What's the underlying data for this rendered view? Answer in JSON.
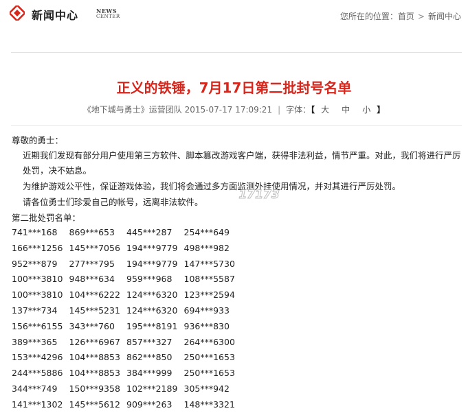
{
  "header": {
    "section_title": "新闻中心",
    "news_logo_line1": "NEWS",
    "news_logo_line2": "CENTER",
    "breadcrumb_prefix": "您所在的位置：",
    "breadcrumb_home": "首页",
    "breadcrumb_sep": ">",
    "breadcrumb_current": "新闻中心",
    "accent_color": "#d7261c"
  },
  "article": {
    "title": "正义的铁锤，7月17日第二批封号名单",
    "source": "《地下城与勇士》运营团队",
    "datetime": "2015-07-17 17:09:21",
    "font_label": "字体：",
    "bracket_open": "【",
    "bracket_close": "】",
    "font_sizes": [
      "大",
      "中",
      "小"
    ]
  },
  "body": {
    "greeting": "尊敬的勇士：",
    "para1": "近期我们发现有部分用户使用第三方软件、脚本篡改游戏客户端，获得非法利益，情节严重。对此，我们将进行严厉处罚，决不姑息。",
    "para2": "为维护游戏公平性，保证游戏体验，我们将会通过多方面监测外挂使用情况，并对其进行严厉处罚。",
    "para3": "请各位勇士们珍爱自己的帐号，远离非法软件。",
    "list_title": "第二批处罚名单："
  },
  "watermark_text": "17173",
  "banned_accounts": [
    [
      "741***168",
      "869***653",
      "445***287",
      "254***649"
    ],
    [
      "166***1256",
      "145***7056",
      "194***9779",
      "498***982"
    ],
    [
      "952***879",
      "277***795",
      "194***9779",
      "147***5730"
    ],
    [
      "100***3810",
      "948***634",
      "959***968",
      "108***5587"
    ],
    [
      "100***3810",
      "104***6222",
      "124***6320",
      "123***2594"
    ],
    [
      "137***734",
      "145***5231",
      "124***6320",
      "694***933"
    ],
    [
      "156***6155",
      "343***760",
      "195***8191",
      "936***830"
    ],
    [
      "389***365",
      "126***6967",
      "857***327",
      "264***6300"
    ],
    [
      "153***4296",
      "104***8853",
      "862***850",
      "250***1653"
    ],
    [
      "244***5886",
      "104***8853",
      "384***999",
      "250***1653"
    ],
    [
      "344***749",
      "150***9358",
      "102***2189",
      "305***942"
    ],
    [
      "141***1302",
      "145***5612",
      "909***263",
      "148***3321"
    ]
  ]
}
